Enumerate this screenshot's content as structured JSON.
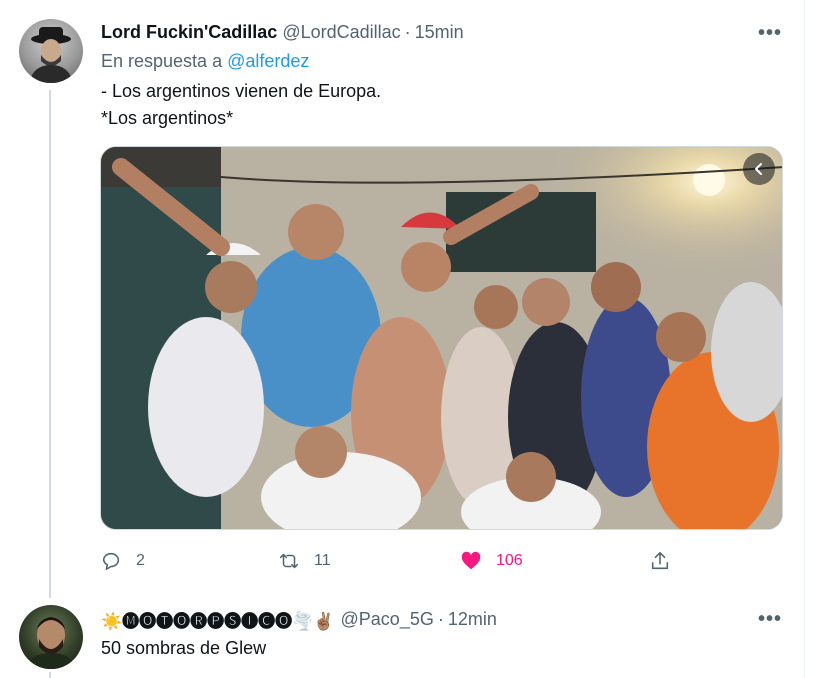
{
  "tweet1": {
    "display_name": "Lord Fuckin'Cadillac",
    "handle": "@LordCadillac",
    "separator": "·",
    "time": "15min",
    "reply_prefix": "En respuesta a",
    "reply_to": "@alferdez",
    "text_line1": "- Los argentinos vienen de Europa.",
    "text_line2": "*Los argentinos*",
    "more_icon": "more-horizontal-icon",
    "media_alt": "photo",
    "media_nav_icon": "chevron-left-icon",
    "actions": {
      "reply_count": "2",
      "retweet_count": "11",
      "like_count": "106",
      "liked": true
    }
  },
  "tweet2": {
    "display_name": "☀️🅜🅞🅣🅞🅡🅟🅢🅘🅒🅞🌪️✌🏽",
    "handle": "@Paco_5G",
    "separator": "·",
    "time": "12min",
    "text": "50 sombras de Glew"
  },
  "colors": {
    "link": "#1d9bf0",
    "muted": "#536471",
    "like": "#f91880",
    "thread_line": "#cfd9de"
  }
}
